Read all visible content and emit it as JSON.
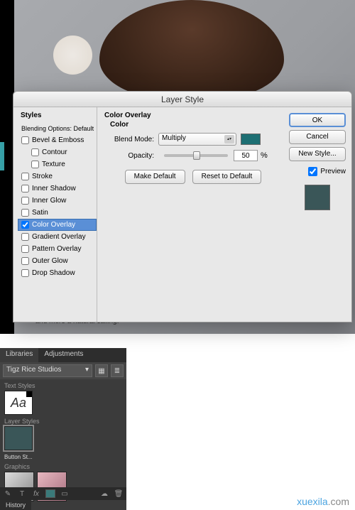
{
  "caption": "and more a natural calling.",
  "dialog": {
    "title": "Layer Style",
    "styles_header": "Styles",
    "blending_header": "Blending Options: Default",
    "items": [
      {
        "label": "Bevel & Emboss",
        "checked": false,
        "sub": false
      },
      {
        "label": "Contour",
        "checked": false,
        "sub": true
      },
      {
        "label": "Texture",
        "checked": false,
        "sub": true
      },
      {
        "label": "Stroke",
        "checked": false,
        "sub": false
      },
      {
        "label": "Inner Shadow",
        "checked": false,
        "sub": false
      },
      {
        "label": "Inner Glow",
        "checked": false,
        "sub": false
      },
      {
        "label": "Satin",
        "checked": false,
        "sub": false
      },
      {
        "label": "Color Overlay",
        "checked": true,
        "sub": false,
        "selected": true
      },
      {
        "label": "Gradient Overlay",
        "checked": false,
        "sub": false
      },
      {
        "label": "Pattern Overlay",
        "checked": false,
        "sub": false
      },
      {
        "label": "Outer Glow",
        "checked": false,
        "sub": false
      },
      {
        "label": "Drop Shadow",
        "checked": false,
        "sub": false
      }
    ],
    "panel_title": "Color Overlay",
    "sub_title": "Color",
    "blend_mode_label": "Blend Mode:",
    "blend_mode_value": "Multiply",
    "color_swatch": "#1d6f73",
    "opacity_label": "Opacity:",
    "opacity_value": "50",
    "opacity_unit": "%",
    "make_default": "Make Default",
    "reset_default": "Reset to Default",
    "ok": "OK",
    "cancel": "Cancel",
    "new_style": "New Style...",
    "preview_label": "Preview",
    "preview_color": "#3a5658"
  },
  "libraries": {
    "tab_libraries": "Libraries",
    "tab_adjustments": "Adjustments",
    "dropdown": "Tigz Rice Studios",
    "text_styles": "Text Styles",
    "aa": "Aa",
    "layer_styles": "Layer Styles",
    "layer_thumb_label": "Button St...",
    "graphics": "Graphics",
    "history": "History"
  },
  "watermark": {
    "main": "xuexila",
    "suffix": ".com"
  }
}
